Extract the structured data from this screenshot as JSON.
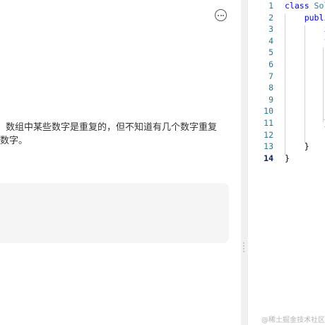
{
  "problem": {
    "description_lines": [
      "数组中某些数字是重复的，但不知道有几个数字重复",
      "数字。"
    ]
  },
  "editor": {
    "line_numbers": [
      "1",
      "2",
      "3",
      "4",
      "5",
      "6",
      "7",
      "8",
      "9",
      "10",
      "11",
      "12",
      "13",
      "14"
    ],
    "active_line": "14",
    "lines": [
      {
        "parts": [
          {
            "t": "class ",
            "c": "kw"
          },
          {
            "t": "Sol",
            "c": "cls"
          }
        ]
      },
      {
        "parts": [
          {
            "t": "    publi",
            "c": "kw"
          }
        ]
      },
      {
        "parts": [
          {
            "t": "        i",
            "c": "kw"
          }
        ]
      },
      {
        "parts": [
          {
            "t": "        f",
            "c": "kw2"
          }
        ]
      },
      {
        "parts": []
      },
      {
        "parts": []
      },
      {
        "parts": []
      },
      {
        "parts": []
      },
      {
        "parts": []
      },
      {
        "parts": []
      },
      {
        "parts": [
          {
            "t": "        }",
            "c": ""
          }
        ]
      },
      {
        "parts": [
          {
            "t": "        r",
            "c": "kw2"
          }
        ]
      },
      {
        "parts": [
          {
            "t": "    }",
            "c": ""
          }
        ]
      },
      {
        "parts": [
          {
            "t": "}",
            "c": ""
          }
        ]
      }
    ]
  },
  "watermark": "@稀土掘金技术社区",
  "icons": {
    "more": "more-options-icon",
    "drag": "drag-handle-icon"
  }
}
